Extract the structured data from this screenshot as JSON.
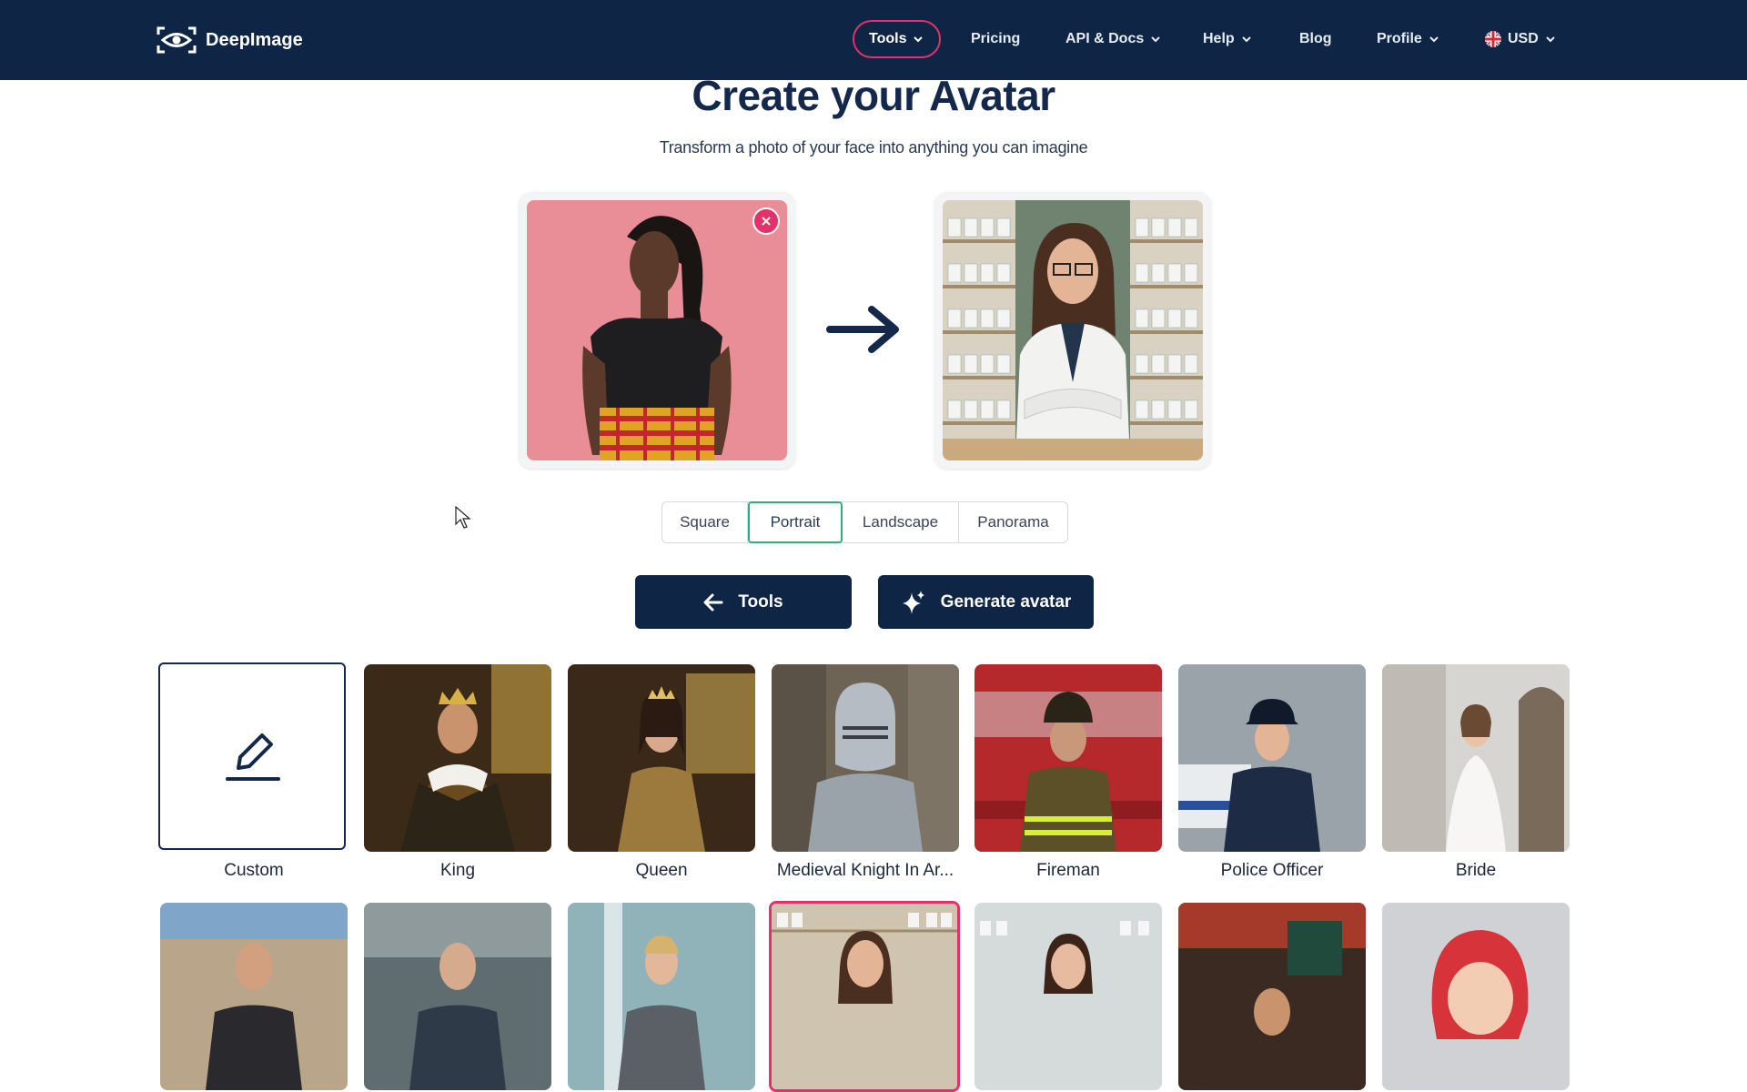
{
  "nav": {
    "brand": "DeepImage",
    "items": [
      {
        "label": "Tools",
        "has_chevron": true,
        "active": true
      },
      {
        "label": "Pricing",
        "has_chevron": false
      },
      {
        "label": "API & Docs",
        "has_chevron": true
      },
      {
        "label": "Help",
        "has_chevron": true
      },
      {
        "label": "Blog",
        "has_chevron": false
      },
      {
        "label": "Profile",
        "has_chevron": true
      },
      {
        "label": "USD",
        "has_chevron": true,
        "icon": "uk-flag-icon"
      }
    ]
  },
  "hero": {
    "title": "Create your Avatar",
    "subtitle": "Transform a photo of your face into anything you can imagine"
  },
  "images": {
    "input_alt": "Uploaded face photo",
    "output_alt": "Generated pharmacist avatar",
    "remove_icon": "close-icon",
    "arrow_icon": "arrow-right-icon"
  },
  "aspect_ratios": {
    "options": [
      "Square",
      "Portrait",
      "Landscape",
      "Panorama"
    ],
    "selected": "Portrait"
  },
  "actions": {
    "back_label": "Tools",
    "back_icon": "arrow-left-icon",
    "generate_label": "Generate avatar",
    "generate_icon": "sparkle-icon"
  },
  "styles": {
    "row1": [
      "Custom",
      "King",
      "Queen",
      "Medieval Knight In Ar...",
      "Fireman",
      "Police Officer",
      "Bride"
    ],
    "selected_row2_index": 3
  },
  "colors": {
    "navy": "#0f2545",
    "accent_pink": "#e2316b",
    "selected_green": "#2fb07a"
  }
}
